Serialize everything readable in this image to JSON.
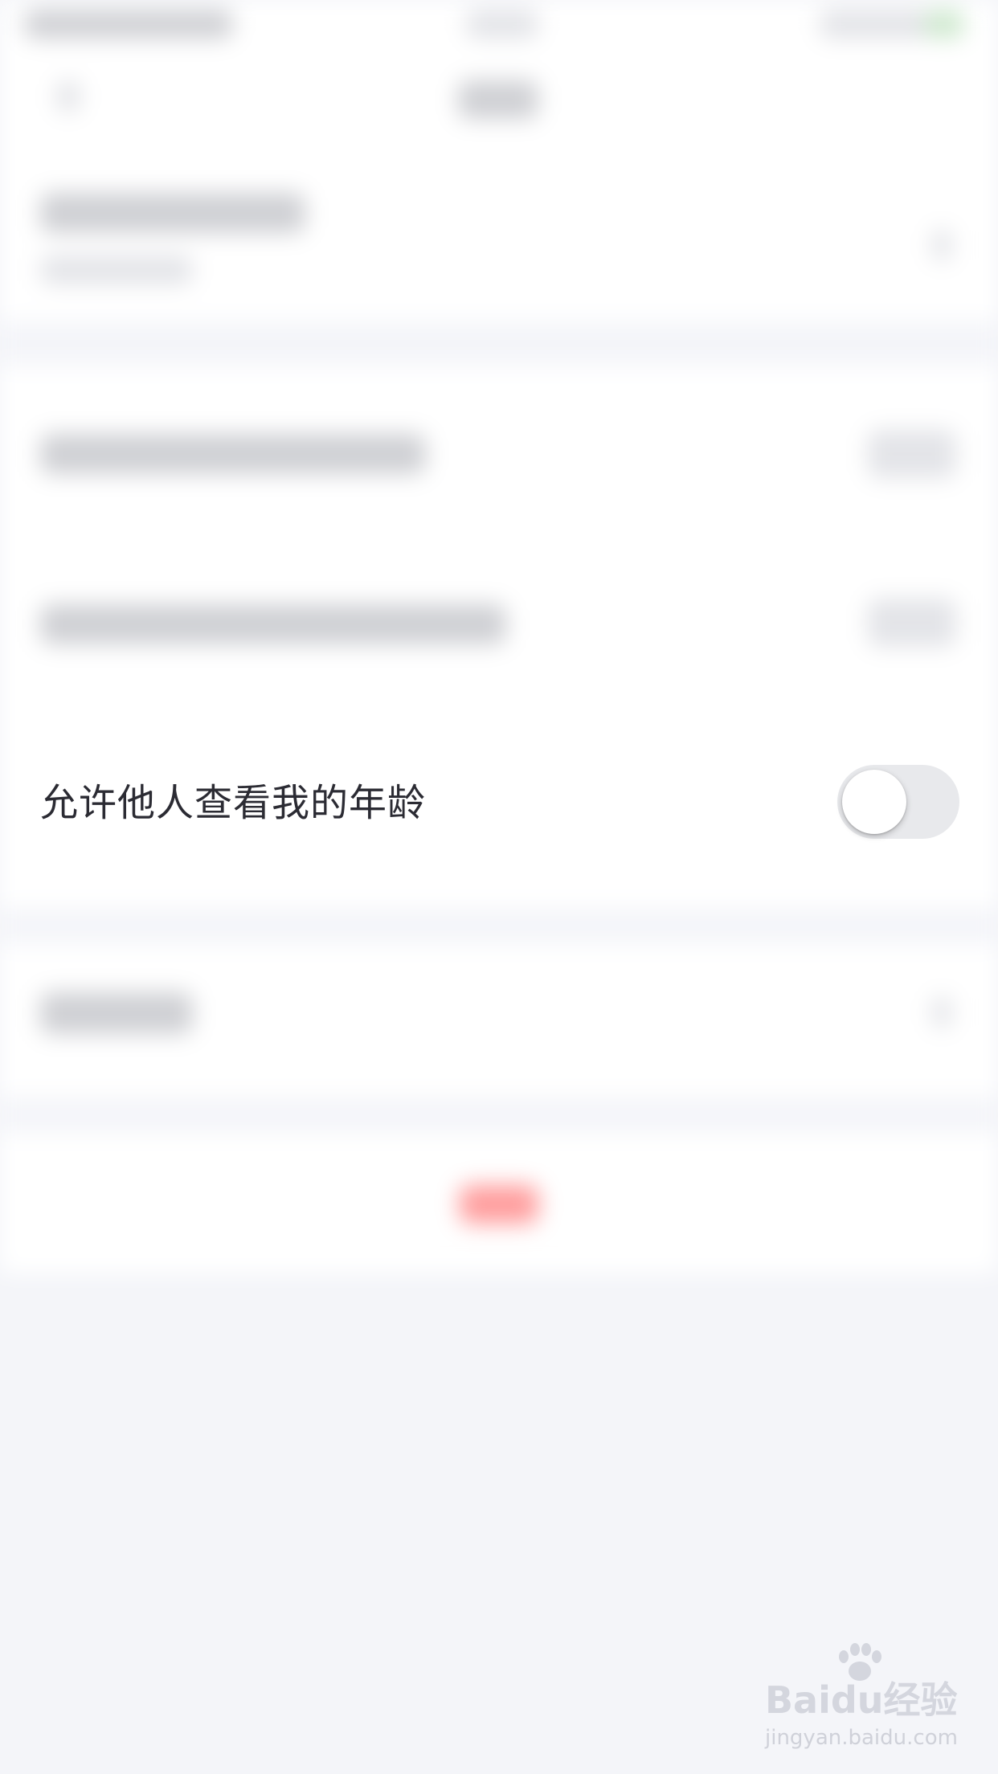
{
  "setting_row": {
    "label": "允许他人查看我的年龄",
    "toggle_on": false
  },
  "colors": {
    "background": "#f4f5f9",
    "row_background": "#ffffff",
    "label_text": "#2b2b33",
    "toggle_track_off": "#e8e9ec",
    "toggle_knob": "#ffffff",
    "accent_blurred": "#ff9d9d"
  },
  "watermark": {
    "brand": "Baidu经验",
    "url": "jingyan.baidu.com"
  },
  "icons": {
    "watermark": "baidu-paw-icon"
  }
}
